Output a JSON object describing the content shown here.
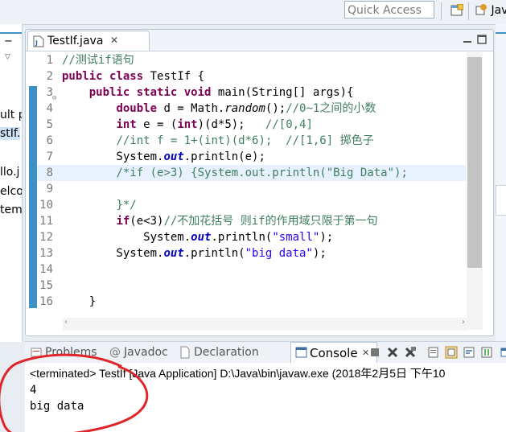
{
  "toolbar": {
    "quick_access_placeholder": "Quick Access",
    "perspective_label": "Jav"
  },
  "left_strip": {
    "items": [
      "ult p",
      "stIf.",
      "llo.j",
      "elco",
      "tem"
    ]
  },
  "editor": {
    "tab_label": "TestIf.java",
    "lines": [
      {
        "no": "1",
        "parts": [
          [
            "cm",
            "//测试if语句"
          ]
        ]
      },
      {
        "no": "2",
        "parts": [
          [
            "kw",
            "public"
          ],
          [
            "",
            " "
          ],
          [
            "kw",
            "class"
          ],
          [
            "",
            " TestIf {"
          ]
        ]
      },
      {
        "no": "3",
        "parts": [
          [
            "",
            "    "
          ],
          [
            "kw",
            "public"
          ],
          [
            "",
            " "
          ],
          [
            "kw",
            "static"
          ],
          [
            "",
            " "
          ],
          [
            "kw",
            "void"
          ],
          [
            "",
            " main(String[] args){"
          ]
        ]
      },
      {
        "no": "4",
        "parts": [
          [
            "",
            "        "
          ],
          [
            "kw",
            "double"
          ],
          [
            "",
            " d = Math."
          ],
          [
            "it",
            "random"
          ],
          [
            "",
            "();"
          ],
          [
            "cm",
            "//0~1之间的小数"
          ]
        ]
      },
      {
        "no": "5",
        "parts": [
          [
            "",
            "        "
          ],
          [
            "kw",
            "int"
          ],
          [
            "",
            " e = ("
          ],
          [
            "kw",
            "int"
          ],
          [
            "",
            ")(d*5);   "
          ],
          [
            "cm",
            "//[0,4]"
          ]
        ]
      },
      {
        "no": "6",
        "parts": [
          [
            "",
            "        "
          ],
          [
            "cm",
            "//int f = 1+(int)(d*6);  //[1,6] 掷色子"
          ]
        ]
      },
      {
        "no": "7",
        "parts": [
          [
            "",
            "        System."
          ],
          [
            "fld",
            "out"
          ],
          [
            "",
            ".println(e);"
          ]
        ]
      },
      {
        "no": "8",
        "parts": [
          [
            "",
            "        "
          ],
          [
            "cm",
            "/*if (e>3) {System.out.println(\"Big Data\");"
          ]
        ]
      },
      {
        "no": "9",
        "parts": []
      },
      {
        "no": "10",
        "parts": [
          [
            "",
            "        "
          ],
          [
            "cm",
            "}*/"
          ]
        ]
      },
      {
        "no": "11",
        "parts": [
          [
            "",
            "        "
          ],
          [
            "kw",
            "if"
          ],
          [
            "",
            "(e<3)"
          ],
          [
            "cm",
            "//不加花括号 则if的作用域只限于第一句"
          ]
        ]
      },
      {
        "no": "12",
        "parts": [
          [
            "",
            "            System."
          ],
          [
            "fld",
            "out"
          ],
          [
            "",
            ".println("
          ],
          [
            "str",
            "\"small\""
          ],
          [
            "",
            ");"
          ]
        ]
      },
      {
        "no": "13",
        "parts": [
          [
            "",
            "        System."
          ],
          [
            "fld",
            "out"
          ],
          [
            "",
            ".println("
          ],
          [
            "str",
            "\"big data\""
          ],
          [
            "",
            ");"
          ]
        ]
      },
      {
        "no": "14",
        "parts": []
      },
      {
        "no": "15",
        "parts": []
      },
      {
        "no": "16",
        "parts": [
          [
            "",
            "    }"
          ]
        ]
      }
    ]
  },
  "bottom_tabs": {
    "problems": "Problems",
    "javadoc": "Javadoc",
    "declaration": "Declaration",
    "console": "Console"
  },
  "console": {
    "header": "<terminated> TestIf [Java Application] D:\\Java\\bin\\javaw.exe (2018年2月5日 下午10",
    "output": [
      "4",
      "big data"
    ]
  },
  "colors": {
    "keyword": "#7f0055",
    "comment": "#3f7f5f",
    "string": "#2a00ff",
    "field": "#0000c0",
    "annotation_circle": "#e0252a"
  }
}
